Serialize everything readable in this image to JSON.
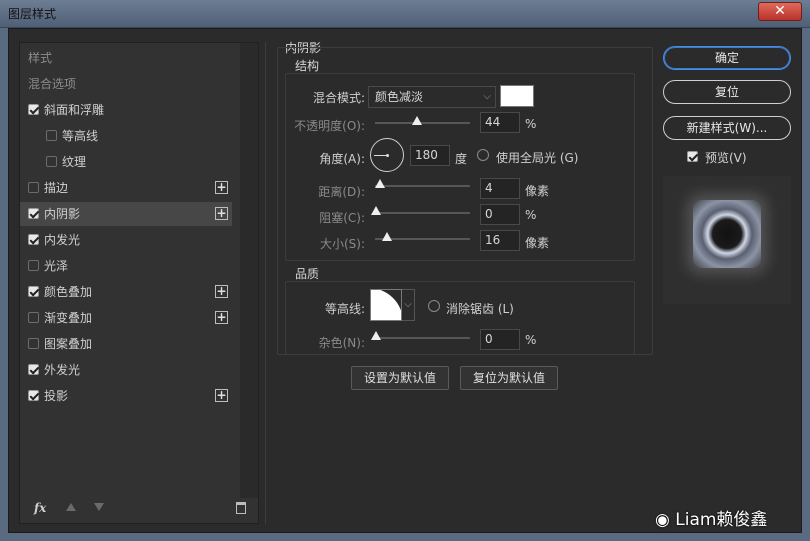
{
  "window": {
    "title": "图层样式",
    "close_glyph": "✕"
  },
  "left_panel": {
    "header_styles": "样式",
    "header_blending": "混合选项",
    "items": [
      {
        "label": "斜面和浮雕",
        "checked": true,
        "plus": false
      },
      {
        "label": "等高线",
        "checked": false,
        "plus": false
      },
      {
        "label": "纹理",
        "checked": false,
        "plus": false
      },
      {
        "label": "描边",
        "checked": false,
        "plus": true
      },
      {
        "label": "内阴影",
        "checked": true,
        "plus": true
      },
      {
        "label": "内发光",
        "checked": true,
        "plus": false
      },
      {
        "label": "光泽",
        "checked": false,
        "plus": false
      },
      {
        "label": "颜色叠加",
        "checked": true,
        "plus": true
      },
      {
        "label": "渐变叠加",
        "checked": false,
        "plus": true
      },
      {
        "label": "图案叠加",
        "checked": false,
        "plus": false
      },
      {
        "label": "外发光",
        "checked": true,
        "plus": false
      },
      {
        "label": "投影",
        "checked": true,
        "plus": true
      }
    ],
    "selected_item": "内阴影",
    "footer": {
      "fx": "fx"
    }
  },
  "inner_shadow": {
    "section_title": "内阴影",
    "structure_title": "结构",
    "blend_mode_label": "混合模式:",
    "blend_mode_value": "颜色减淡",
    "blend_color": "#ffffff",
    "opacity_label": "不透明度(O):",
    "opacity_value": "44",
    "opacity_unit": "%",
    "angle_label": "角度(A):",
    "angle_value": "180",
    "angle_unit": "度",
    "global_light_label": "使用全局光 (G)",
    "distance_label": "距离(D):",
    "distance_value": "4",
    "distance_unit": "像素",
    "choke_label": "阻塞(C):",
    "choke_value": "0",
    "choke_unit": "%",
    "size_label": "大小(S):",
    "size_value": "16",
    "size_unit": "像素",
    "quality_title": "品质",
    "contour_label": "等高线:",
    "anti_alias_label": "消除锯齿 (L)",
    "noise_label": "杂色(N):",
    "noise_value": "0",
    "noise_unit": "%",
    "make_default": "设置为默认值",
    "reset_default": "复位为默认值"
  },
  "right_panel": {
    "ok": "确定",
    "reset": "复位",
    "new_style": "新建样式(W)...",
    "preview_label": "预览(V)",
    "preview_checked": true
  },
  "watermark": "Liam赖俊鑫"
}
